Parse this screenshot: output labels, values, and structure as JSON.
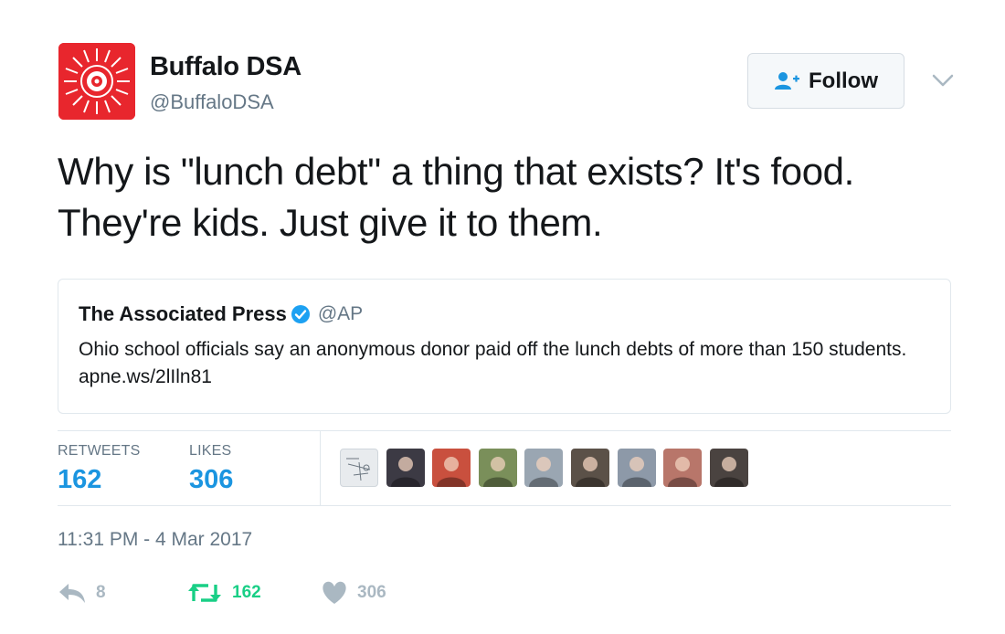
{
  "author": {
    "display_name": "Buffalo DSA",
    "handle": "@BuffaloDSA",
    "avatar_icon": "dsa-rose-logo",
    "avatar_color": "#e8262d"
  },
  "follow_button": {
    "label": "Follow",
    "icon": "add-user-icon",
    "accent": "#1b95e0"
  },
  "menu": {
    "icon": "chevron-down-icon"
  },
  "tweet": {
    "text": "Why is \"lunch debt\" a thing that exists? It's food. They're kids. Just give it to them."
  },
  "quoted_tweet": {
    "name": "The Associated Press",
    "verified": true,
    "handle": "@AP",
    "text": "Ohio school officials say an anonymous donor paid off the lunch debts of more than 150 students. apne.ws/2lIln81"
  },
  "stats": {
    "retweets": {
      "label": "RETWEETS",
      "value": "162"
    },
    "likes": {
      "label": "LIKES",
      "value": "306"
    }
  },
  "likers": [
    {
      "name": "liker-avatar-1",
      "color": "#e8ebee"
    },
    {
      "name": "liker-avatar-2",
      "color": "#3c3a44"
    },
    {
      "name": "liker-avatar-3",
      "color": "#c9503e"
    },
    {
      "name": "liker-avatar-4",
      "color": "#7a8f5a"
    },
    {
      "name": "liker-avatar-5",
      "color": "#9aa6b2"
    },
    {
      "name": "liker-avatar-6",
      "color": "#5b5148"
    },
    {
      "name": "liker-avatar-7",
      "color": "#8d99a8"
    },
    {
      "name": "liker-avatar-8",
      "color": "#b8766a"
    },
    {
      "name": "liker-avatar-9",
      "color": "#4a4340"
    }
  ],
  "timestamp": "11:31 PM - 4 Mar 2017",
  "actions": {
    "reply": {
      "icon": "reply-icon",
      "count": "8",
      "color": "#aab8c2"
    },
    "retweet": {
      "icon": "retweet-icon",
      "count": "162",
      "color": "#19cf86"
    },
    "like": {
      "icon": "heart-icon",
      "count": "306",
      "color": "#aab8c2"
    }
  }
}
